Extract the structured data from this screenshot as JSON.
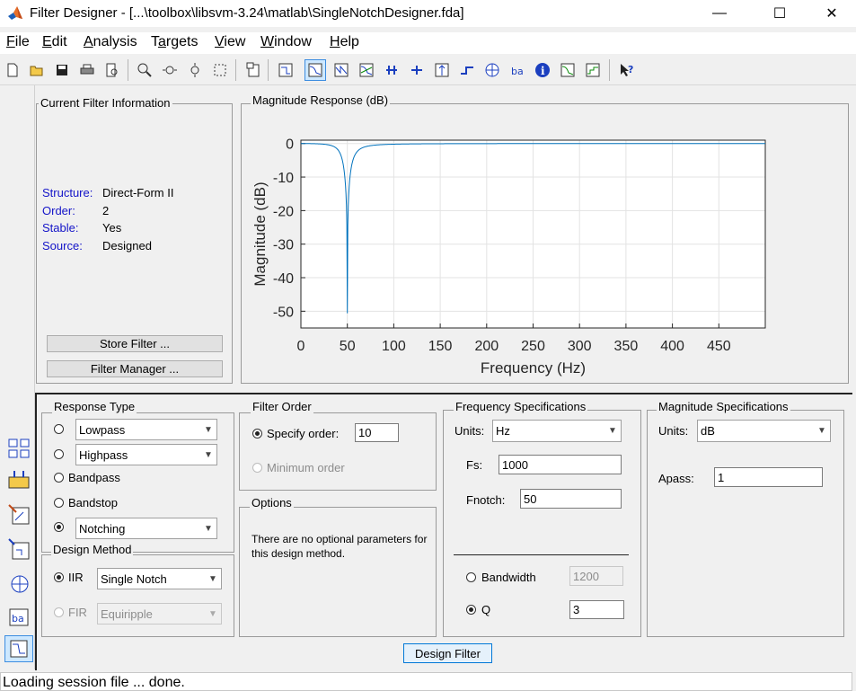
{
  "window": {
    "title": "Filter Designer - [...\\toolbox\\libsvm-3.24\\matlab\\SingleNotchDesigner.fda]",
    "minimize": "—",
    "maximize": "☐",
    "close": "✕"
  },
  "menu": [
    "File",
    "Edit",
    "Analysis",
    "Targets",
    "View",
    "Window",
    "Help"
  ],
  "toolbar_icons": [
    "new-icon",
    "open-icon",
    "save-icon",
    "print-icon",
    "print-preview-icon",
    "zoom-in-icon",
    "zoom-x-icon",
    "zoom-y-icon",
    "full-view-icon",
    "new-figure-icon",
    "filter-specs-icon",
    "magnitude-response-icon",
    "phase-response-icon",
    "mag-phase-icon",
    "group-delay-icon",
    "phase-delay-icon",
    "impulse-response-icon",
    "step-response-icon",
    "pole-zero-icon",
    "coefficients-icon",
    "info-icon",
    "magnitude-estimate-icon",
    "noise-psd-icon",
    "whats-this-icon"
  ],
  "current_filter": {
    "title": "Current Filter Information",
    "rows": [
      {
        "label": "Structure:",
        "value": "Direct-Form II"
      },
      {
        "label": "Order:",
        "value": "2"
      },
      {
        "label": "Stable:",
        "value": "Yes"
      },
      {
        "label": "Source:",
        "value": "Designed"
      }
    ],
    "store_button": "Store Filter ...",
    "manager_button": "Filter Manager ..."
  },
  "magnitude_panel_title": "Magnitude Response (dB)",
  "chart_data": {
    "type": "line",
    "title": "",
    "xlabel": "Frequency (Hz)",
    "ylabel": "Magnitude (dB)",
    "xlim": [
      0,
      500
    ],
    "ylim": [
      -55,
      1
    ],
    "xticks": [
      0,
      50,
      100,
      150,
      200,
      250,
      300,
      350,
      400,
      450
    ],
    "yticks": [
      0,
      -10,
      -20,
      -30,
      -40,
      -50
    ],
    "grid": true,
    "notch_frequency": 50,
    "min_value": -50.6,
    "series": [
      {
        "color": "#0072bd"
      }
    ]
  },
  "response_type": {
    "title": "Response Type",
    "lowpass": "Lowpass",
    "highpass": "Highpass",
    "bandpass": "Bandpass",
    "bandstop": "Bandstop",
    "notching": "Notching"
  },
  "design_method": {
    "title": "Design Method",
    "iir_label": "IIR",
    "iir_value": "Single Notch",
    "fir_label": "FIR",
    "fir_value": "Equiripple"
  },
  "filter_order": {
    "title": "Filter Order",
    "specify_label": "Specify order:",
    "specify_value": "10",
    "minimum_label": "Minimum order"
  },
  "options": {
    "title": "Options",
    "text": "There are no optional parameters for this design method."
  },
  "freq_specs": {
    "title": "Frequency Specifications",
    "units_label": "Units:",
    "units_value": "Hz",
    "fs_label": "Fs:",
    "fs_value": "1000",
    "fnotch_label": "Fnotch:",
    "fnotch_value": "50",
    "bandwidth_label": "Bandwidth",
    "bandwidth_value": "1200",
    "q_label": "Q",
    "q_value": "3"
  },
  "mag_specs": {
    "title": "Magnitude Specifications",
    "units_label": "Units:",
    "units_value": "dB",
    "apass_label": "Apass:",
    "apass_value": "1"
  },
  "design_button": "Design Filter",
  "status": "Loading session file ... done."
}
